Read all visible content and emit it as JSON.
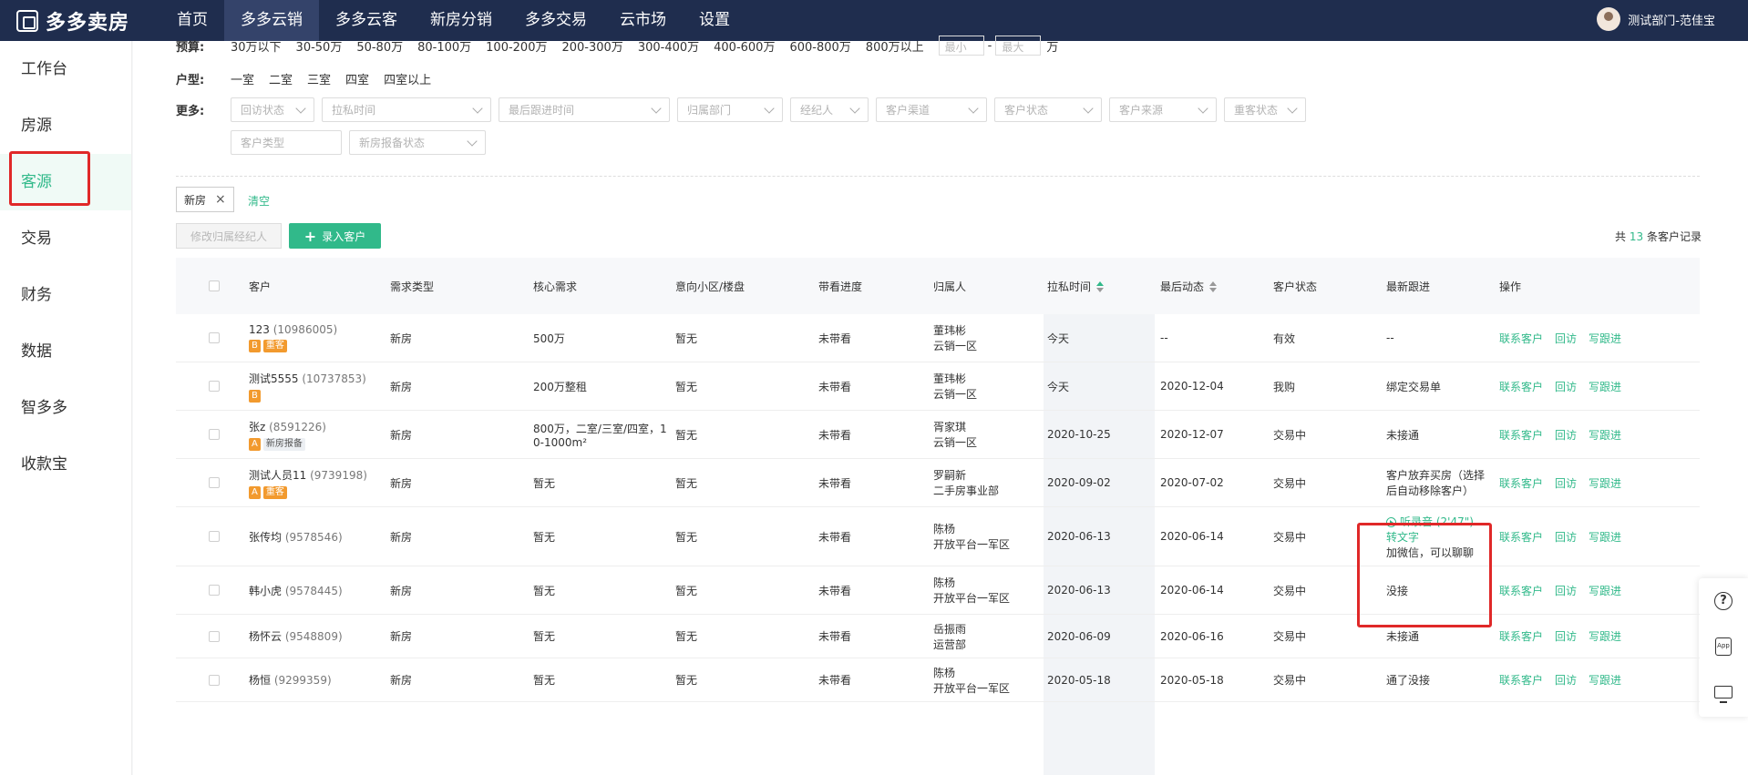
{
  "app": {
    "logo": "多多卖房",
    "user": "测试部门-范佳宝"
  },
  "nav": [
    "首页",
    "多多云销",
    "多多云客",
    "新房分销",
    "多多交易",
    "云市场",
    "设置"
  ],
  "nav_active": 1,
  "sidebar": [
    "工作台",
    "房源",
    "客源",
    "交易",
    "财务",
    "数据",
    "智多多",
    "收款宝"
  ],
  "sidebar_active": 2,
  "filters": {
    "budget": {
      "label": "预算:",
      "options": [
        "30万以下",
        "30-50万",
        "50-80万",
        "80-100万",
        "100-200万",
        "200-300万",
        "300-400万",
        "400-600万",
        "600-800万",
        "800万以上"
      ],
      "min": "最小",
      "sep": "-",
      "max": "最大",
      "unit": "万"
    },
    "layout": {
      "label": "户型:",
      "options": [
        "一室",
        "二室",
        "三室",
        "四室",
        "四室以上"
      ]
    },
    "more": {
      "label": "更多:",
      "row1": [
        "回访状态",
        "拉私时间",
        "最后跟进时间",
        "归属部门",
        "经纪人",
        "客户渠道",
        "客户状态",
        "客户来源",
        "重客状态"
      ],
      "row2": [
        "客户类型",
        "新房报备状态"
      ]
    }
  },
  "selected_tag": "新房",
  "clear_label": "清空",
  "toolbar": {
    "change_agent": "修改归属经纪人",
    "add_customer": "录入客户"
  },
  "total": {
    "prefix": "共",
    "count": "13",
    "suffix": "条客户记录"
  },
  "columns": [
    "客户",
    "需求类型",
    "核心需求",
    "意向小区/楼盘",
    "带看进度",
    "归属人",
    "拉私时间",
    "最后动态",
    "客户状态",
    "最新跟进",
    "操作"
  ],
  "ops": [
    "联系客户",
    "回访",
    "写跟进"
  ],
  "rows": [
    {
      "name": "123",
      "id": "(10986005)",
      "badges": [
        "B",
        "重客"
      ],
      "type": "新房",
      "need": "500万",
      "estate": "暂无",
      "progress": "未带看",
      "owner1": "董玮彬",
      "owner2": "云销一区",
      "private_time": "今天",
      "last": "--",
      "status": "有效",
      "follow": "--"
    },
    {
      "name": "测试5555",
      "id": "(10737853)",
      "badges": [
        "B"
      ],
      "type": "新房",
      "need": "200万整租",
      "estate": "暂无",
      "progress": "未带看",
      "owner1": "董玮彬",
      "owner2": "云销一区",
      "private_time": "今天",
      "last": "2020-12-04",
      "status": "我购",
      "follow": "绑定交易单"
    },
    {
      "name": "张z",
      "id": "(8591226)",
      "badges": [
        "A",
        "新房报备"
      ],
      "type": "新房",
      "need": "800万，二室/三室/四室，1",
      "need2": "0-1000m²",
      "estate": "暂无",
      "progress": "未带看",
      "owner1": "胥家琪",
      "owner2": "云销一区",
      "private_time": "2020-10-25",
      "last": "2020-12-07",
      "status": "交易中",
      "follow": "未接通"
    },
    {
      "name": "测试人员11",
      "id": "(9739198)",
      "badges": [
        "A",
        "重客"
      ],
      "type": "新房",
      "need": "暂无",
      "estate": "暂无",
      "progress": "未带看",
      "owner1": "罗嗣新",
      "owner2": "二手房事业部",
      "private_time": "2020-09-02",
      "last": "2020-07-02",
      "status": "交易中",
      "follow": "客户放弃买房（选择",
      "follow2": "后自动移除客户）"
    },
    {
      "name": "张传均",
      "id": "(9578546)",
      "badges": [],
      "type": "新房",
      "need": "暂无",
      "estate": "暂无",
      "progress": "未带看",
      "owner1": "陈杨",
      "owner2": "开放平台一军区",
      "private_time": "2020-06-13",
      "last": "2020-06-14",
      "status": "交易中",
      "audio": "听录音",
      "audio_len": "(2'47\")",
      "transcribe": "转文字",
      "follow": "加微信，可以聊聊"
    },
    {
      "name": "韩小虎",
      "id": "(9578445)",
      "badges": [],
      "type": "新房",
      "need": "暂无",
      "estate": "暂无",
      "progress": "未带看",
      "owner1": "陈杨",
      "owner2": "开放平台一军区",
      "private_time": "2020-06-13",
      "last": "2020-06-14",
      "status": "交易中",
      "follow": "没接"
    },
    {
      "name": "杨怀云",
      "id": "(9548809)",
      "badges": [],
      "type": "新房",
      "need": "暂无",
      "estate": "暂无",
      "progress": "未带看",
      "owner1": "岳振雨",
      "owner2": "运营部",
      "private_time": "2020-06-09",
      "last": "2020-06-16",
      "status": "交易中",
      "follow": "未接通"
    },
    {
      "name": "杨恒",
      "id": "(9299359)",
      "badges": [],
      "type": "新房",
      "need": "暂无",
      "estate": "暂无",
      "progress": "未带看",
      "owner1": "陈杨",
      "owner2": "开放平台一军区",
      "private_time": "2020-05-18",
      "last": "2020-05-18",
      "status": "交易中",
      "follow": "通了没接"
    }
  ],
  "float_tools": [
    "help-icon",
    "app-icon",
    "monitor-icon"
  ],
  "tool_app_text": "App"
}
